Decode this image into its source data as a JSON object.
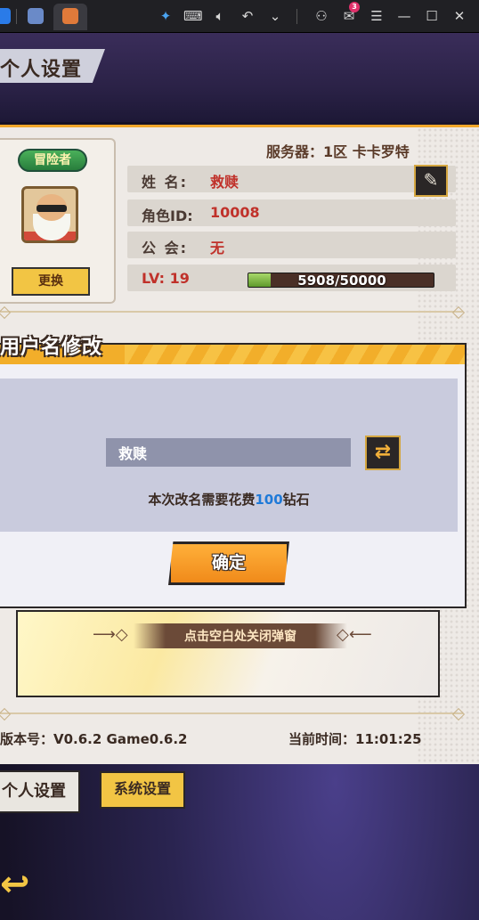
{
  "titlebar": {
    "mail_count": "3",
    "icons": [
      "app-icon-1",
      "app-icon-2",
      "game-tab-icon",
      "pin-icon",
      "keyboard-icon",
      "volume-icon",
      "rotate-icon",
      "chevron-down-icon",
      "user-icon",
      "mail-icon",
      "menu-icon",
      "minimize-icon",
      "maximize-icon",
      "close-icon"
    ]
  },
  "header": {
    "title": "个人设置"
  },
  "profile": {
    "badge": "冒险者",
    "change_button": "更换",
    "server": "服务器：1区 卡卡罗特",
    "name_label": "姓 名:",
    "name_value": "救赎",
    "role_id_label": "角色ID:",
    "role_id_value": "10008",
    "guild_label": "公 会:",
    "guild_value": "无",
    "level": "LV: 19",
    "xp_text": "5908/50000",
    "xp_fraction": 0.118
  },
  "dialog": {
    "title": "用户名修改",
    "input_value": "救赎",
    "cost_prefix": "本次改名需要花费",
    "cost_amount": "100",
    "cost_suffix": "钻石",
    "confirm_button": "确定"
  },
  "hint": {
    "close_text": "点击空白处关闭弹窗"
  },
  "footer": {
    "version": "版本号：V0.6.2 Game0.6.2",
    "time": "当前时间：11:01:25"
  },
  "tabs": {
    "personal": "个人设置",
    "system": "系统设置"
  },
  "colors": {
    "accent_orange": "#f2ae2a",
    "value_red": "#c0312a",
    "cost_blue": "#1f7ad8",
    "xp_green": "#7fbf44"
  }
}
